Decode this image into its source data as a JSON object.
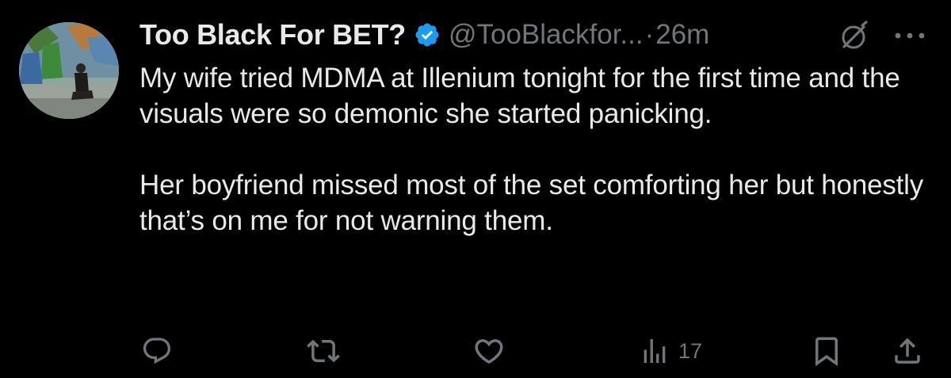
{
  "tweet": {
    "author": {
      "display_name": "Too Black For BET?",
      "handle": "@TooBlackfor...",
      "verified": true,
      "verified_color": "#1d9bf0"
    },
    "separator": "·",
    "time": "26m",
    "body": {
      "paragraph1": "My wife tried MDMA at Illenium tonight for the first time and the visuals were so demonic she started panicking.",
      "paragraph2": "Her boyfriend missed most of the set comforting her but honestly that’s on me for not warning them."
    },
    "actions": {
      "reply_icon": "reply-icon",
      "retweet_icon": "retweet-icon",
      "like_icon": "heart-icon",
      "views_icon": "analytics-icon",
      "views_count": "17",
      "bookmark_icon": "bookmark-icon",
      "share_icon": "share-icon"
    },
    "header_icons": [
      "grok-icon",
      "more-icon"
    ]
  },
  "colors": {
    "background": "#000000",
    "primary_text": "#e7e9ea",
    "secondary_text": "#71767b"
  }
}
